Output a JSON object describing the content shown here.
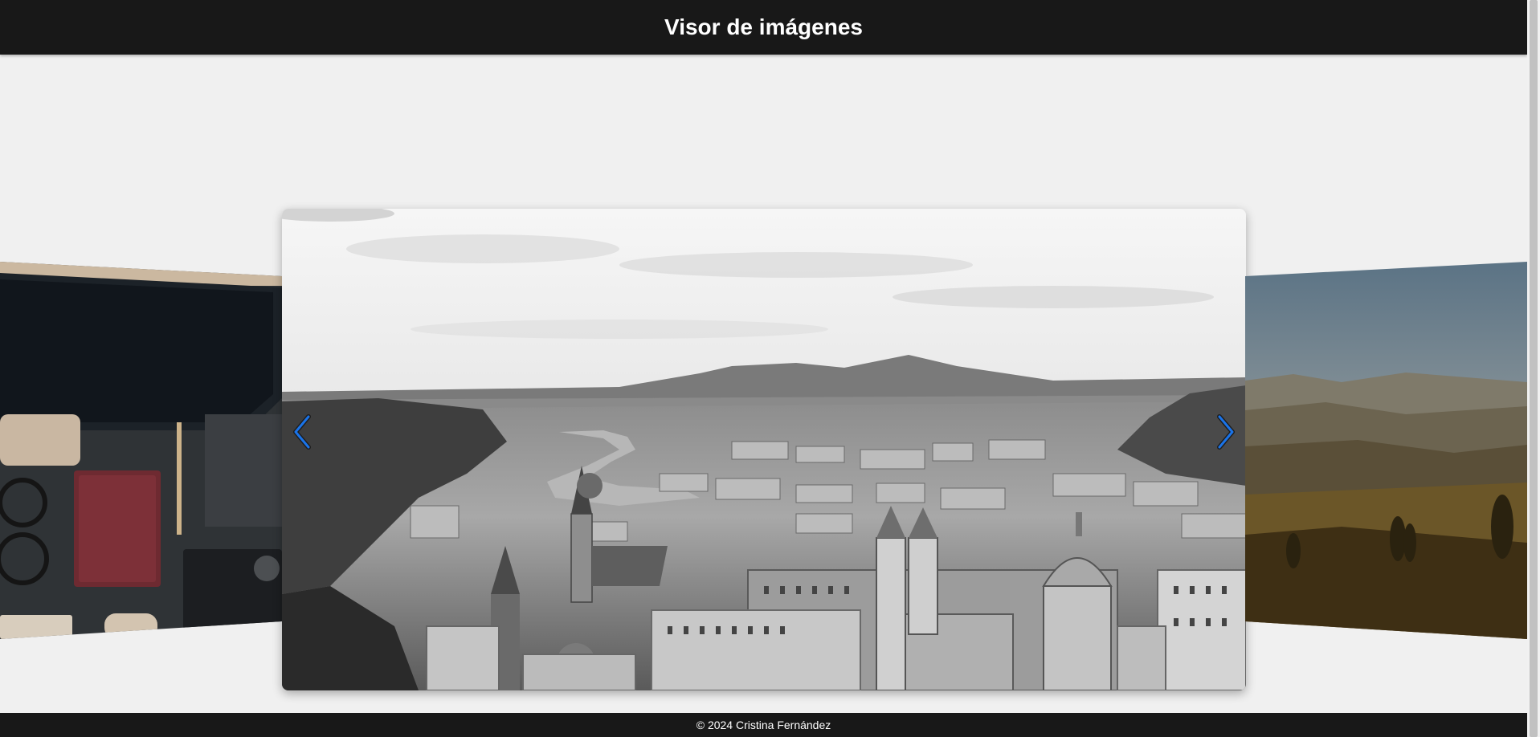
{
  "header": {
    "title": "Visor de imágenes"
  },
  "carousel": {
    "slides": [
      {
        "name": "desk-workspace-photo",
        "position": "previous"
      },
      {
        "name": "salzburg-city-photo",
        "position": "current"
      },
      {
        "name": "rolling-hills-landscape-photo",
        "position": "next"
      }
    ],
    "prev_icon": "chevron-left-icon",
    "next_icon": "chevron-right-icon",
    "arrow_color": "#1a73e8"
  },
  "footer": {
    "copyright": "© 2024 Cristina Fernández"
  },
  "colors": {
    "bar_bg": "#181818",
    "page_bg": "#f0f0f0"
  }
}
